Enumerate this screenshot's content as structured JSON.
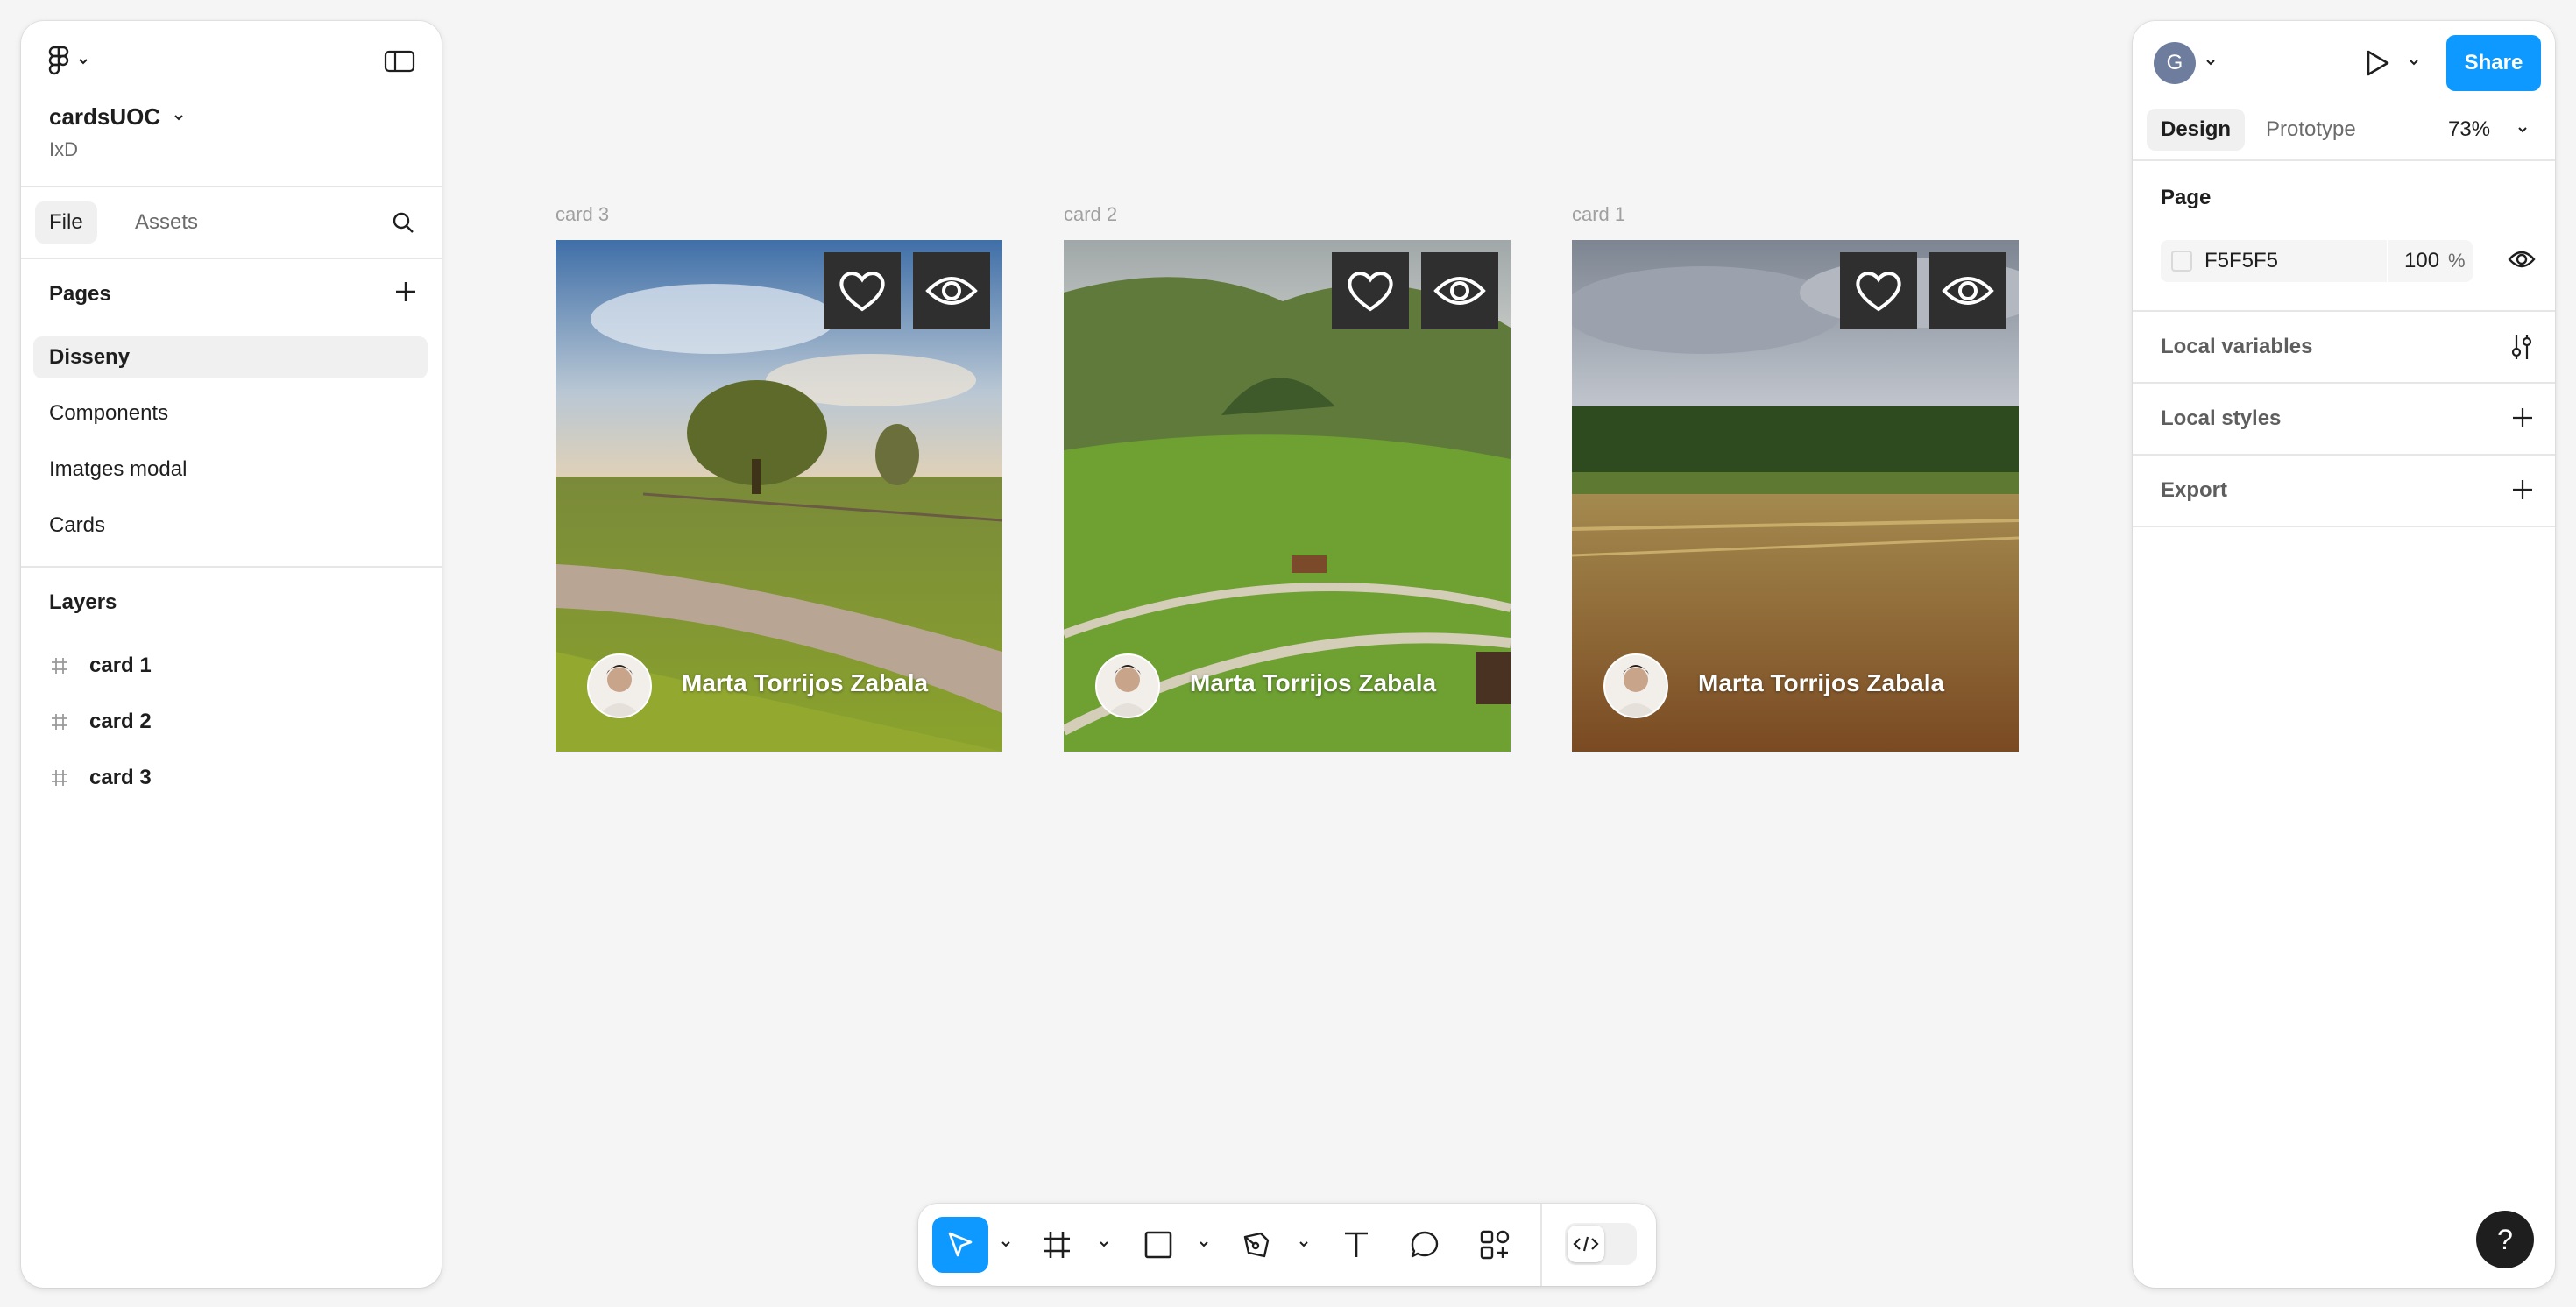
{
  "file": {
    "name": "cardsUOC",
    "team": "IxD"
  },
  "left_tabs": {
    "file": "File",
    "assets": "Assets"
  },
  "pages": {
    "title": "Pages",
    "items": [
      "Disseny",
      "Components",
      "Imatges modal",
      "Cards"
    ],
    "selected": "Disseny"
  },
  "layers": {
    "title": "Layers",
    "items": [
      "card 1",
      "card 2",
      "card 3"
    ]
  },
  "frames": [
    {
      "label": "card 3",
      "author": "Marta Torrijos Zabala"
    },
    {
      "label": "card 2",
      "author": "Marta Torrijos Zabala"
    },
    {
      "label": "card 1",
      "author": "Marta Torrijos Zabala"
    }
  ],
  "header": {
    "user_initial": "G",
    "share_label": "Share"
  },
  "right_tabs": {
    "design": "Design",
    "prototype": "Prototype",
    "zoom": "73%"
  },
  "page_section": {
    "title": "Page",
    "bg_color": "F5F5F5",
    "opacity": "100",
    "opacity_unit": "%"
  },
  "sections": {
    "local_variables": "Local variables",
    "local_styles": "Local styles",
    "export": "Export"
  },
  "help": "?",
  "colors": {
    "accent": "#0d99ff",
    "canvas": "#f5f5f5",
    "card_button": "#2f2f2f"
  },
  "icons": {
    "toolbar": [
      "move-tool-icon",
      "frame-tool-icon",
      "rectangle-tool-icon",
      "pen-tool-icon",
      "text-tool-icon",
      "comment-tool-icon",
      "actions-icon",
      "dev-mode-icon"
    ]
  }
}
